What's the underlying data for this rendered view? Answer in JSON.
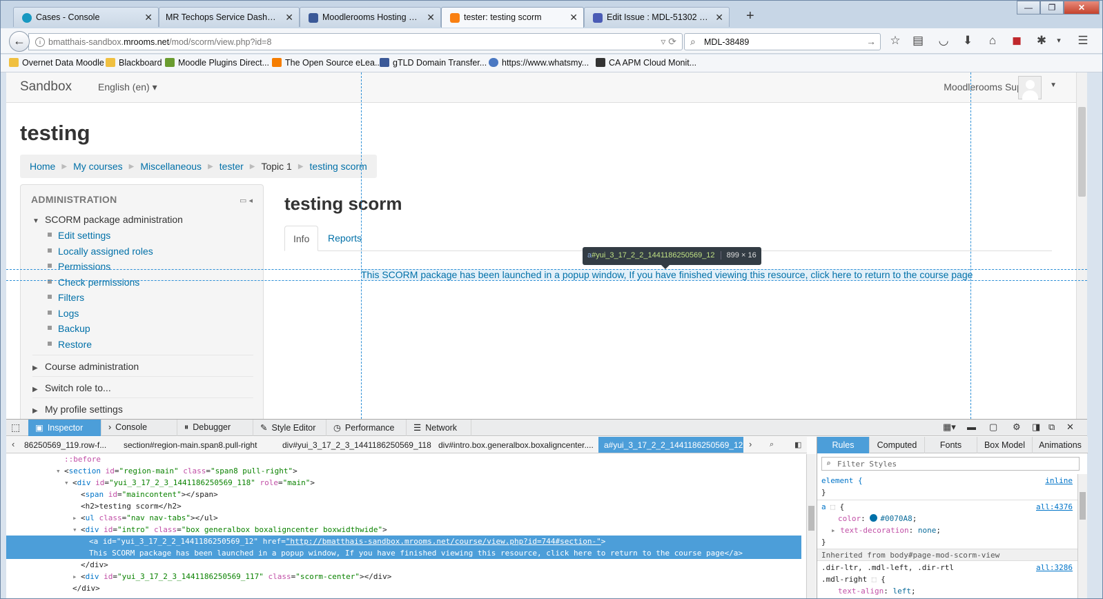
{
  "browser": {
    "tabs": [
      {
        "label": "Cases - Console",
        "favicon": "salesforce-cloud-icon",
        "color": "#1798c1"
      },
      {
        "label": "MR Techops Service Dashboard",
        "favicon": "",
        "color": ""
      },
      {
        "label": "Moodlerooms Hosting Ma...",
        "favicon": "moodlerooms-icon",
        "color": "#3b5998"
      },
      {
        "label": "tester: testing scorm",
        "favicon": "moodle-m-icon",
        "color": "#f98012"
      },
      {
        "label": "Edit Issue : MDL-51302 - M...",
        "favicon": "moodle-tracker-icon",
        "color": "#4a5bb5"
      }
    ],
    "new_tab": "+",
    "window_controls": {
      "minimize": "—",
      "maximize": "❐",
      "close": "✕"
    },
    "url_prefix": "bmatthais-sandbox.",
    "url_domain": "mrooms.net",
    "url_path": "/mod/scorm/view.php?id=8",
    "search_value": "MDL-38489",
    "bookmarks": [
      {
        "label": "Overnet Data Moodle",
        "icon": "folder-icon",
        "color": "#f0c040"
      },
      {
        "label": "Blackboard",
        "icon": "folder-icon",
        "color": "#f0c040"
      },
      {
        "label": "Moodle Plugins Direct...",
        "icon": "moodle-plugins-icon",
        "color": "#6a9c2f"
      },
      {
        "label": "The Open Source eLea...",
        "icon": "blogger-icon",
        "color": "#f57d00"
      },
      {
        "label": "gTLD Domain Transfer...",
        "icon": "facebook-icon",
        "color": "#3b5998"
      },
      {
        "label": "https://www.whatsmy...",
        "icon": "globe-icon",
        "color": "#4a78c2"
      },
      {
        "label": "CA APM Cloud Monit...",
        "icon": "ca-icon",
        "color": "#333333"
      }
    ]
  },
  "page": {
    "site_name": "Sandbox",
    "language": "English (en)",
    "user_name": "Moodlerooms Support",
    "course_title": "testing",
    "breadcrumb": [
      "Home",
      "My courses",
      "Miscellaneous",
      "tester",
      "Topic 1",
      "testing scorm"
    ],
    "admin": {
      "title": "ADMINISTRATION",
      "section": "SCORM package administration",
      "items": [
        "Edit settings",
        "Locally assigned roles",
        "Permissions",
        "Check permissions",
        "Filters",
        "Logs",
        "Backup",
        "Restore"
      ],
      "collapsed": [
        "Course administration",
        "Switch role to...",
        "My profile settings"
      ]
    },
    "activity_title": "testing scorm",
    "tabs": [
      "Info",
      "Reports"
    ],
    "intro_link": "This SCORM package has been launched in a popup window, If you have finished viewing this resource, click here to return to the course page"
  },
  "highlighter": {
    "tag": "a",
    "id": "#yui_3_17_2_2_1441186250569_12",
    "dims": "899 × 16"
  },
  "devtools": {
    "tabs": [
      "Inspector",
      "Console",
      "Debugger",
      "Style Editor",
      "Performance",
      "Network"
    ],
    "breadcrumbs": [
      "86250569_119.row-f...",
      "section#region-main.span8.pull-right",
      "div#yui_3_17_2_3_1441186250569_118",
      "div#intro.box.generalbox.boxaligncenter....",
      "a#yui_3_17_2_2_1441186250569_12"
    ],
    "markup": {
      "before": "::before",
      "l1_tag": "section",
      "l1_a1": "id",
      "l1_v1": "\"region-main\"",
      "l1_a2": "class",
      "l1_v2": "\"span8 pull-right\"",
      "l2_tag": "div",
      "l2_a1": "id",
      "l2_v1": "\"yui_3_17_2_3_1441186250569_118\"",
      "l2_a2": "role",
      "l2_v2": "\"main\"",
      "l3_tag": "span",
      "l3_a1": "id",
      "l3_v1": "\"maincontent\"",
      "l3_close": "></span>",
      "l4": "<h2>testing scorm</h2>",
      "l5_tag": "ul",
      "l5_a1": "class",
      "l5_v1": "\"nav nav-tabs\"",
      "l5_close": "></ul>",
      "l6_tag": "div",
      "l6_a1": "id",
      "l6_v1": "\"intro\"",
      "l6_a2": "class",
      "l6_v2": "\"box generalbox boxaligncenter boxwidthwide\"",
      "l7_pre": "<a ",
      "l7_a1": "id",
      "l7_v1": "\"yui_3_17_2_2_1441186250569_12\"",
      "l7_a2": "href",
      "l7_v2": "\"http://bmatthais-sandbox.mrooms.net/course/view.php?id=744#section-\"",
      "l8": "This SCORM package has been launched in a popup window, If you have finished viewing this resource, click here to return to the course page</a>",
      "l9": "</div>",
      "l10_tag": "div",
      "l10_a1": "id",
      "l10_v1": "\"yui_3_17_2_3_1441186250569_117\"",
      "l10_a2": "class",
      "l10_v2": "\"scorm-center\"",
      "l10_close": "></div>",
      "l11": "</div>"
    },
    "sidebar_tabs": [
      "Rules",
      "Computed",
      "Fonts",
      "Box Model",
      "Animations"
    ],
    "filter_placeholder": "Filter Styles",
    "rules": {
      "element_sel": "element {",
      "element_src": "inline",
      "close": "}",
      "a_sel": "a",
      "a_src": "all:4376",
      "color_prop": "color",
      "color_val": "#0070A8",
      "td_prop": "text-decoration",
      "td_val": "none",
      "inherited": "Inherited from body#page-mod-scorm-view",
      "sel3_line1": ".dir-ltr, .mdl-left, .dir-rtl",
      "sel3_line2": ".mdl-right",
      "sel3_src": "all:3286",
      "ta_prop": "text-align",
      "ta_val": "left"
    }
  }
}
